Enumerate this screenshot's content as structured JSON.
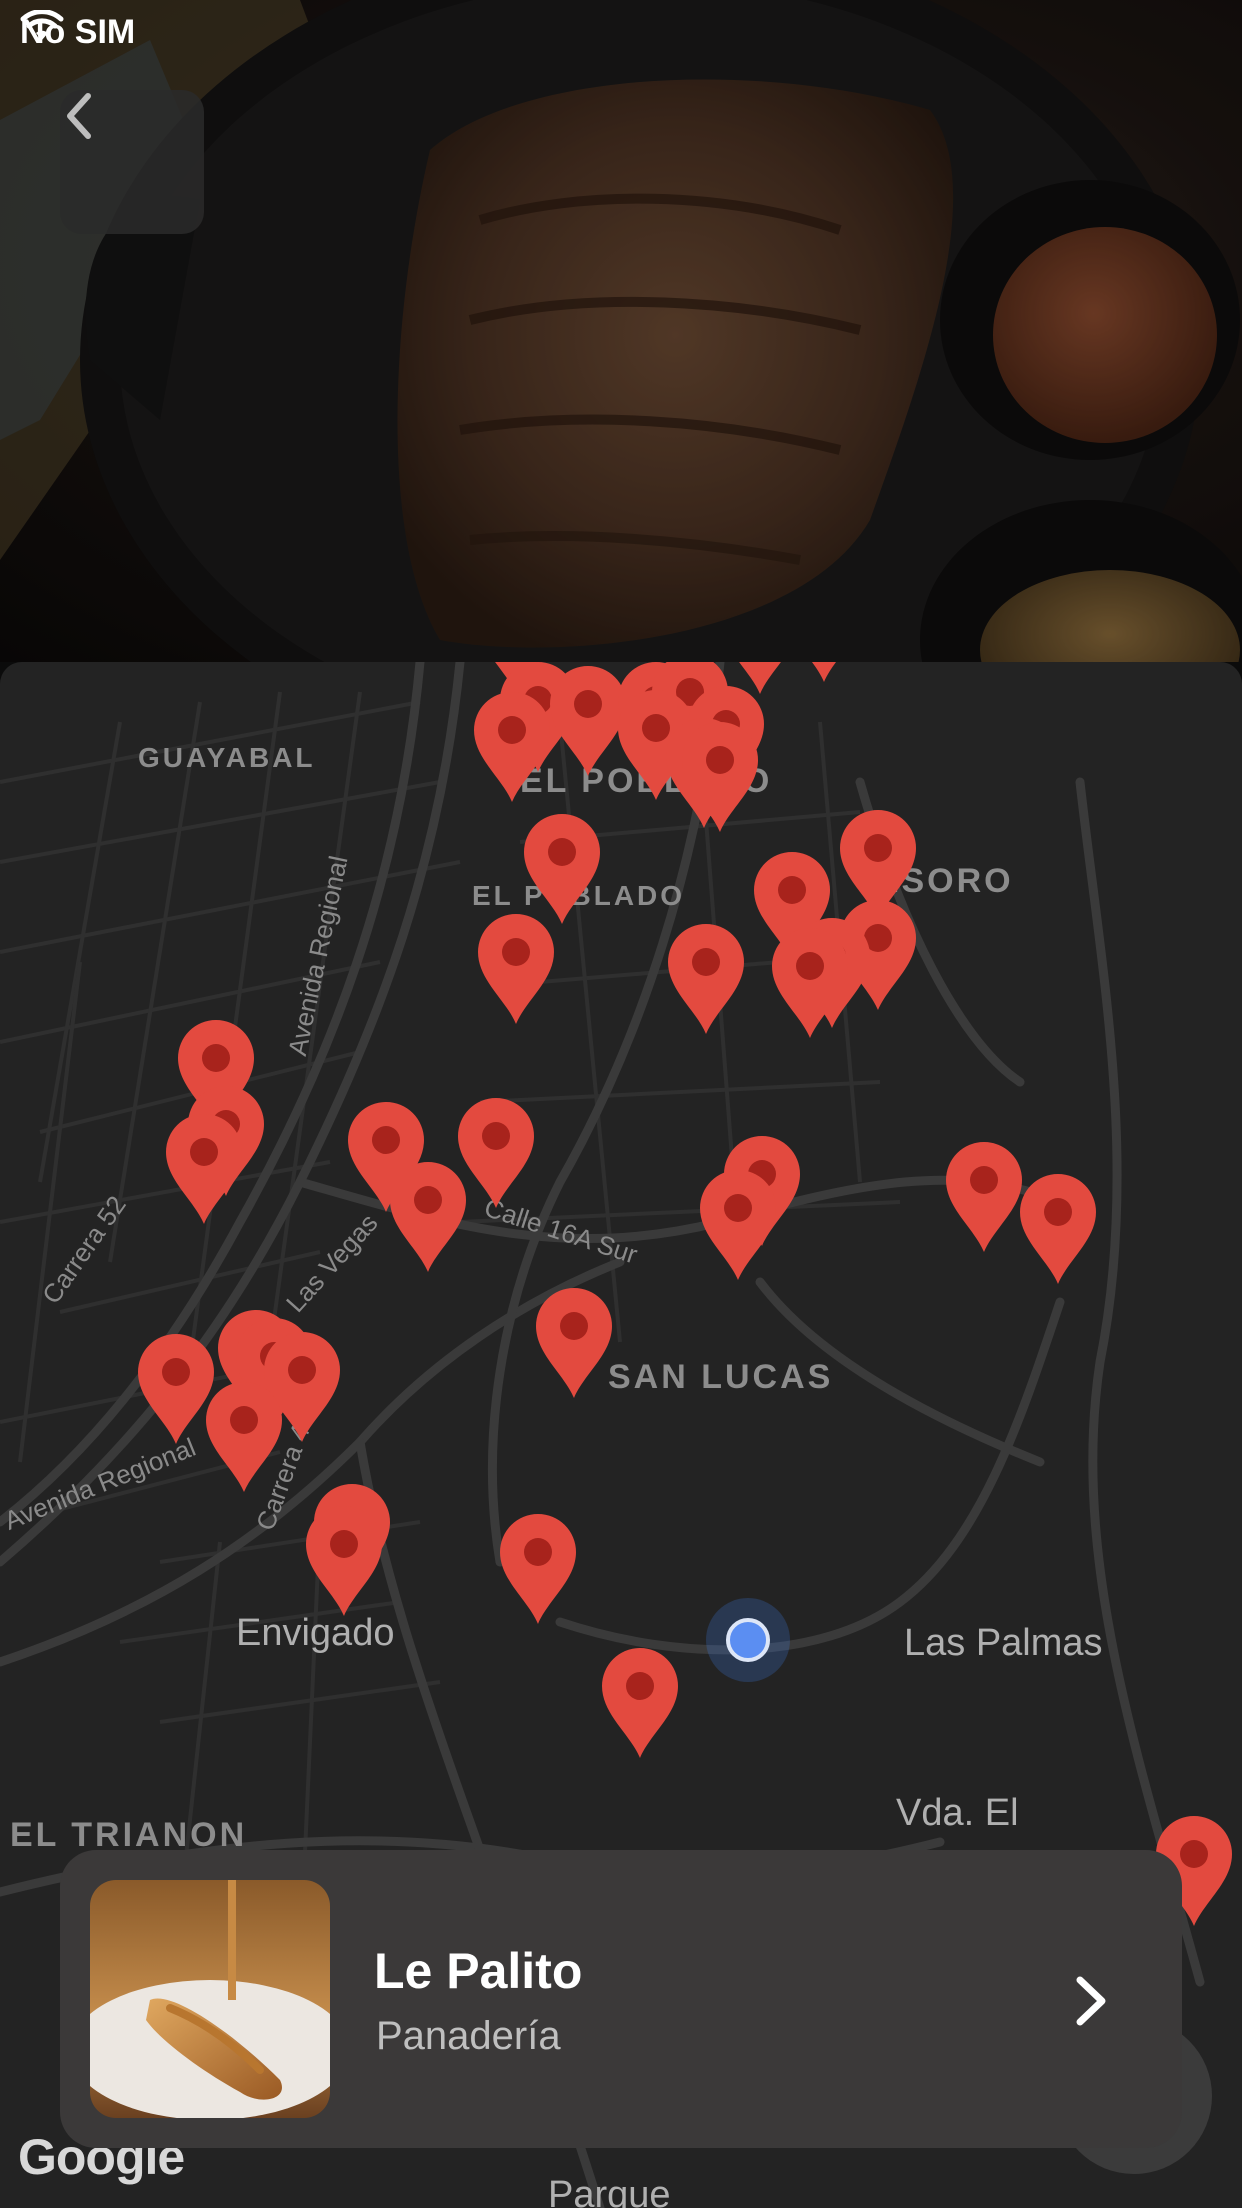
{
  "status_bar": {
    "carrier": "No SIM"
  },
  "map": {
    "areas": [
      {
        "key": "guayabal",
        "text": "GUAYABAL"
      },
      {
        "key": "el_poblado_top",
        "text": "EL POBLADO"
      },
      {
        "key": "el_poblado",
        "text": "EL POBLADO"
      },
      {
        "key": "tesoro",
        "text": "TESORO"
      },
      {
        "key": "san_lucas",
        "text": "SAN LUCAS"
      },
      {
        "key": "el_trianon",
        "text": "EL TRIANON"
      }
    ],
    "cities": [
      {
        "key": "envigado",
        "text": "Envigado"
      },
      {
        "key": "las_palmas",
        "text": "Las Palmas"
      },
      {
        "key": "vda_el",
        "text": "Vda. El"
      },
      {
        "key": "parque",
        "text": "Parque"
      }
    ],
    "streets": [
      {
        "key": "avenida_regional",
        "text": "Avenida Regional"
      },
      {
        "key": "avenida_regional_2",
        "text": "Avenida Regional"
      },
      {
        "key": "carrera_52",
        "text": "Carrera 52"
      },
      {
        "key": "las_vegas",
        "text": "Las Vegas"
      },
      {
        "key": "calle_16a_sur",
        "text": "Calle 16A Sur"
      },
      {
        "key": "carrera_43",
        "text": "Carrera 43"
      }
    ],
    "pin_color": "#E34A3F",
    "user_location_color": "#5B8EF2",
    "attribution": "Google"
  },
  "place_card": {
    "title": "Le Palito",
    "category": "Panadería"
  }
}
